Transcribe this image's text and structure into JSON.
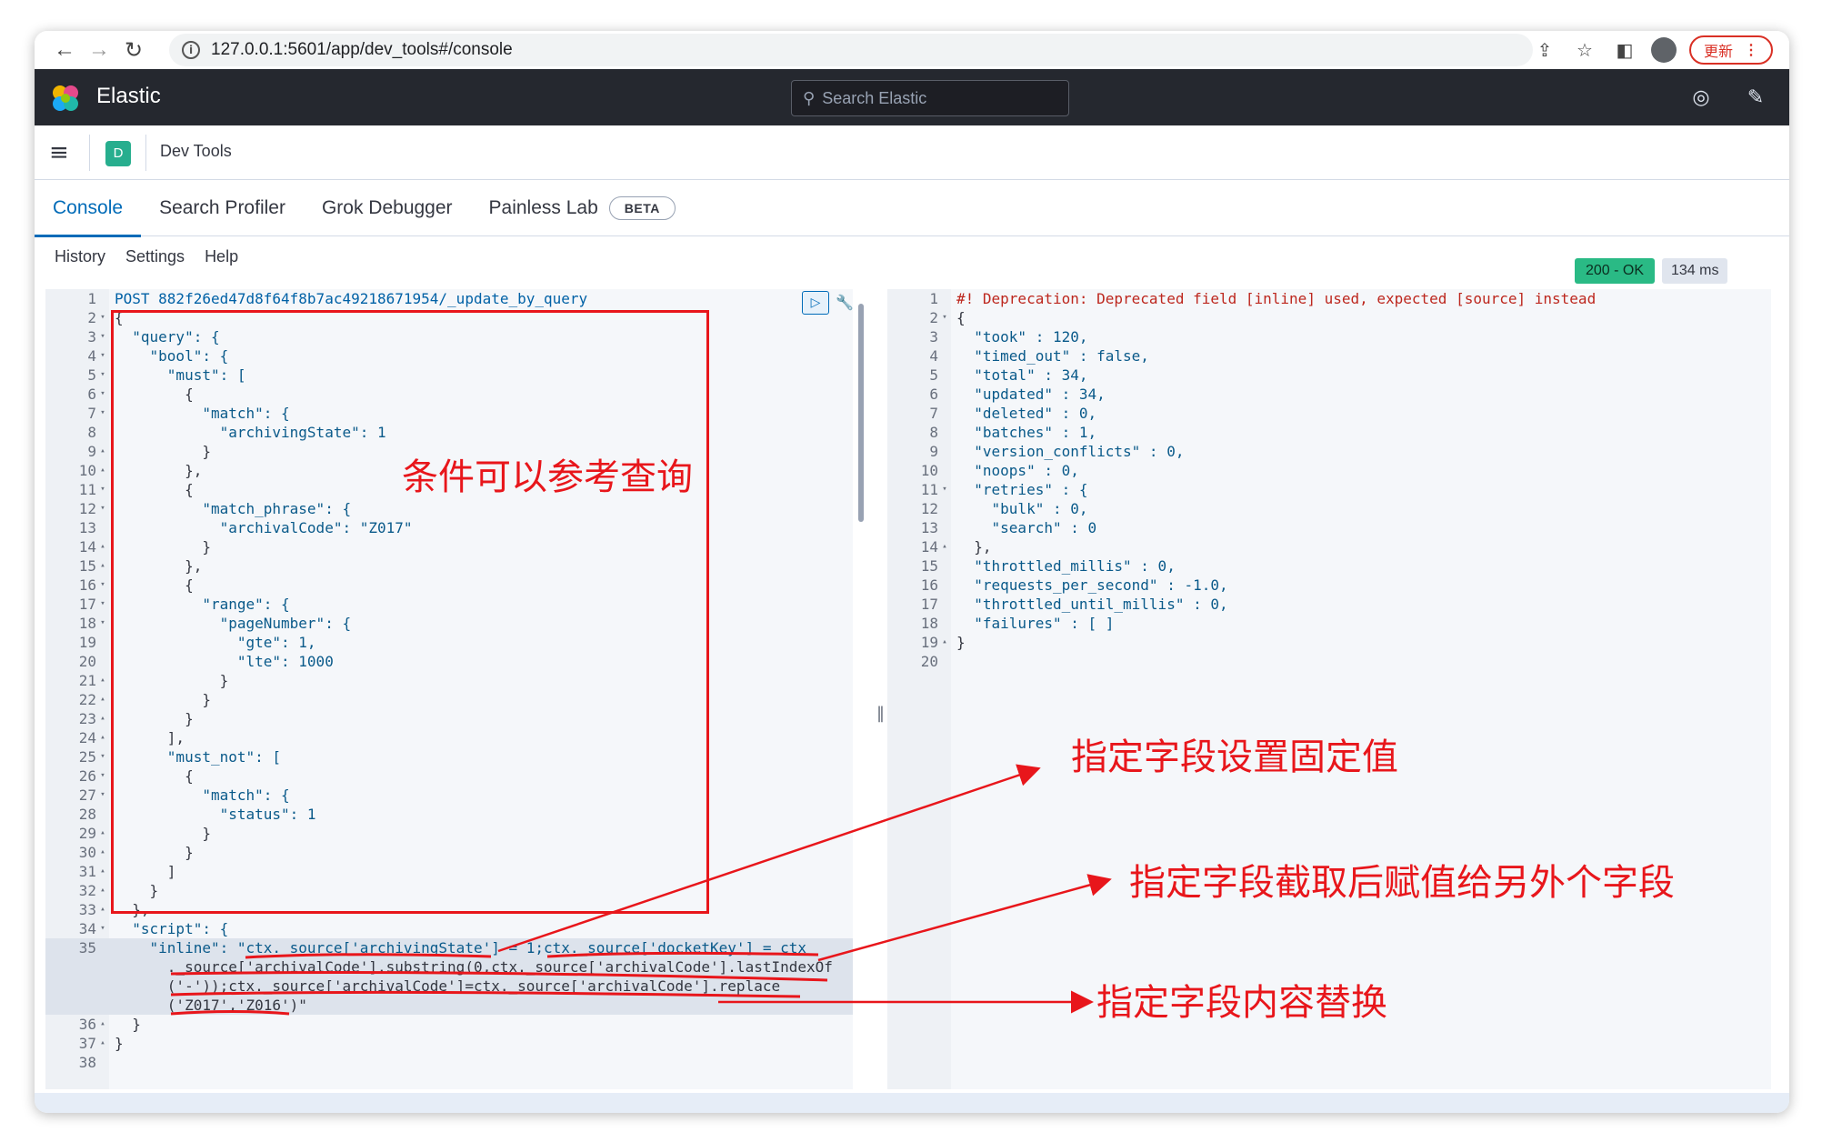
{
  "browser": {
    "url": "127.0.0.1:5601/app/dev_tools#/console",
    "update_label": "更新"
  },
  "elastic": {
    "brand": "Elastic",
    "search_placeholder": "Search Elastic"
  },
  "appbar": {
    "badge": "D",
    "title": "Dev Tools"
  },
  "tabs": [
    {
      "label": "Console",
      "active": true
    },
    {
      "label": "Search Profiler"
    },
    {
      "label": "Grok Debugger"
    },
    {
      "label": "Painless Lab",
      "badge": "BETA"
    }
  ],
  "console_menu": [
    "History",
    "Settings",
    "Help"
  ],
  "status": {
    "code": "200 - OK",
    "time": "134 ms"
  },
  "request_lines": [
    {
      "n": "1",
      "f": "",
      "t": "POST 882f26ed47d8f64f8b7ac49218671954/_update_by_query"
    },
    {
      "n": "2",
      "f": "▾",
      "t": "{"
    },
    {
      "n": "3",
      "f": "▾",
      "t": "  \"query\": {"
    },
    {
      "n": "4",
      "f": "▾",
      "t": "    \"bool\": {"
    },
    {
      "n": "5",
      "f": "▾",
      "t": "      \"must\": ["
    },
    {
      "n": "6",
      "f": "▾",
      "t": "        {"
    },
    {
      "n": "7",
      "f": "▾",
      "t": "          \"match\": {"
    },
    {
      "n": "8",
      "f": "",
      "t": "            \"archivingState\": 1"
    },
    {
      "n": "9",
      "f": "▴",
      "t": "          }"
    },
    {
      "n": "10",
      "f": "▴",
      "t": "        },"
    },
    {
      "n": "11",
      "f": "▾",
      "t": "        {"
    },
    {
      "n": "12",
      "f": "▾",
      "t": "          \"match_phrase\": {"
    },
    {
      "n": "13",
      "f": "",
      "t": "            \"archivalCode\": \"Z017\""
    },
    {
      "n": "14",
      "f": "▴",
      "t": "          }"
    },
    {
      "n": "15",
      "f": "▴",
      "t": "        },"
    },
    {
      "n": "16",
      "f": "▾",
      "t": "        {"
    },
    {
      "n": "17",
      "f": "▾",
      "t": "          \"range\": {"
    },
    {
      "n": "18",
      "f": "▾",
      "t": "            \"pageNumber\": {"
    },
    {
      "n": "19",
      "f": "",
      "t": "              \"gte\": 1,"
    },
    {
      "n": "20",
      "f": "",
      "t": "              \"lte\": 1000"
    },
    {
      "n": "21",
      "f": "▴",
      "t": "            }"
    },
    {
      "n": "22",
      "f": "▴",
      "t": "          }"
    },
    {
      "n": "23",
      "f": "▴",
      "t": "        }"
    },
    {
      "n": "24",
      "f": "▴",
      "t": "      ],"
    },
    {
      "n": "25",
      "f": "▾",
      "t": "      \"must_not\": ["
    },
    {
      "n": "26",
      "f": "▾",
      "t": "        {"
    },
    {
      "n": "27",
      "f": "▾",
      "t": "          \"match\": {"
    },
    {
      "n": "28",
      "f": "",
      "t": "            \"status\": 1"
    },
    {
      "n": "29",
      "f": "▴",
      "t": "          }"
    },
    {
      "n": "30",
      "f": "▴",
      "t": "        }"
    },
    {
      "n": "31",
      "f": "▴",
      "t": "      ]"
    },
    {
      "n": "32",
      "f": "▴",
      "t": "    }"
    },
    {
      "n": "33",
      "f": "▴",
      "t": "  },"
    },
    {
      "n": "34",
      "f": "▾",
      "t": "  \"script\": {"
    },
    {
      "n": "35",
      "f": "",
      "t": "    \"inline\": \"ctx._source['archivingState'] = 1;ctx._source['docketKey'] = ctx",
      "active": true
    },
    {
      "n": "",
      "f": "",
      "t": "      ._source['archivalCode'].substring(0,ctx._source['archivalCode'].lastIndexOf",
      "active": true
    },
    {
      "n": "",
      "f": "",
      "t": "      ('-'));ctx._source['archivalCode']=ctx._source['archivalCode'].replace",
      "active": true
    },
    {
      "n": "",
      "f": "",
      "t": "      ('Z017','Z016')\"",
      "active": true
    },
    {
      "n": "36",
      "f": "▴",
      "t": "  }"
    },
    {
      "n": "37",
      "f": "▴",
      "t": "}"
    },
    {
      "n": "38",
      "f": "",
      "t": ""
    }
  ],
  "response_lines": [
    {
      "n": "1",
      "f": "",
      "t": "#! Deprecation: Deprecated field [inline] used, expected [source] instead"
    },
    {
      "n": "2",
      "f": "▾",
      "t": "{"
    },
    {
      "n": "3",
      "f": "",
      "t": "  \"took\" : 120,"
    },
    {
      "n": "4",
      "f": "",
      "t": "  \"timed_out\" : false,"
    },
    {
      "n": "5",
      "f": "",
      "t": "  \"total\" : 34,"
    },
    {
      "n": "6",
      "f": "",
      "t": "  \"updated\" : 34,"
    },
    {
      "n": "7",
      "f": "",
      "t": "  \"deleted\" : 0,"
    },
    {
      "n": "8",
      "f": "",
      "t": "  \"batches\" : 1,"
    },
    {
      "n": "9",
      "f": "",
      "t": "  \"version_conflicts\" : 0,"
    },
    {
      "n": "10",
      "f": "",
      "t": "  \"noops\" : 0,"
    },
    {
      "n": "11",
      "f": "▾",
      "t": "  \"retries\" : {"
    },
    {
      "n": "12",
      "f": "",
      "t": "    \"bulk\" : 0,"
    },
    {
      "n": "13",
      "f": "",
      "t": "    \"search\" : 0"
    },
    {
      "n": "14",
      "f": "▴",
      "t": "  },"
    },
    {
      "n": "15",
      "f": "",
      "t": "  \"throttled_millis\" : 0,"
    },
    {
      "n": "16",
      "f": "",
      "t": "  \"requests_per_second\" : -1.0,"
    },
    {
      "n": "17",
      "f": "",
      "t": "  \"throttled_until_millis\" : 0,"
    },
    {
      "n": "18",
      "f": "",
      "t": "  \"failures\" : [ ]"
    },
    {
      "n": "19",
      "f": "▴",
      "t": "}"
    },
    {
      "n": "20",
      "f": "",
      "t": ""
    }
  ],
  "annotations": {
    "query_note": "条件可以参考查询",
    "fixed_value_note": "指定字段设置固定值",
    "substring_note": "指定字段截取后赋值给另外个字段",
    "replace_note": "指定字段内容替换"
  },
  "colors": {
    "annotation": "#e8161b",
    "header_bg": "#25282f",
    "link_blue": "#006bb8",
    "status_ok": "#2aba85"
  },
  "icons": {
    "back": "arrow-left-icon",
    "forward": "arrow-right-icon",
    "reload": "reload-icon",
    "info": "info-icon",
    "share": "share-icon",
    "star": "star-icon",
    "sidepanel": "side-panel-icon",
    "profile": "profile-icon",
    "more": "more-vertical-icon",
    "search": "search-icon",
    "help": "help-icon",
    "news": "newsfeed-icon",
    "menu": "hamburger-icon",
    "run": "play-icon",
    "wrench": "wrench-icon"
  }
}
